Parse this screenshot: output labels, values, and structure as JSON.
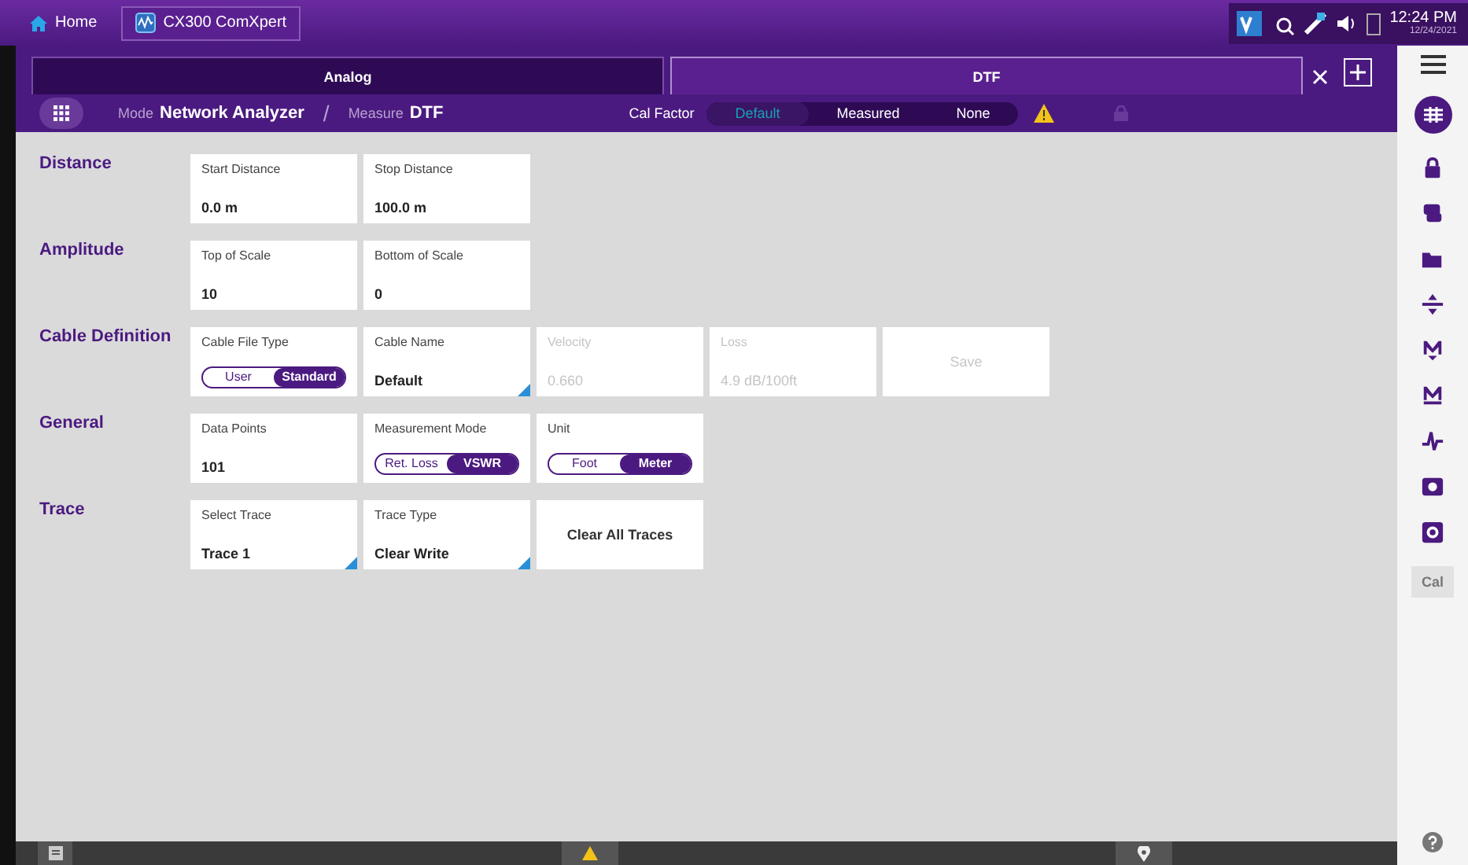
{
  "top_bar": {
    "tabs": [
      {
        "label": "Home",
        "kind": "home",
        "selected": false
      },
      {
        "label": "CX300 ComXpert",
        "kind": "app",
        "selected": true
      }
    ],
    "time": "12:24 PM",
    "date": "12/24/2021"
  },
  "app_tabs": [
    {
      "label": "Analog",
      "selected": false
    },
    {
      "label": "DTF",
      "selected": true
    }
  ],
  "mode_bar": {
    "mode_label": "Mode",
    "mode": "Network Analyzer",
    "separator": "/",
    "measure_label": "Measure",
    "measure": "DTF",
    "cal_factor": {
      "label": "Cal Factor",
      "options": [
        {
          "label": "Default",
          "selected": true
        },
        {
          "label": "Measured",
          "selected": false
        },
        {
          "label": "None",
          "selected": false
        }
      ]
    }
  },
  "sections": [
    {
      "title": "Distance",
      "cards": [
        {
          "kind": "value",
          "label": "Start Distance",
          "value": "0.0 m",
          "dropdown": false,
          "disabled": false
        },
        {
          "kind": "value",
          "label": "Stop Distance",
          "value": "100.0 m",
          "dropdown": false,
          "disabled": false
        }
      ]
    },
    {
      "title": "Amplitude",
      "cards": [
        {
          "kind": "value",
          "label": "Top of Scale",
          "value": "10",
          "dropdown": false,
          "disabled": false
        },
        {
          "kind": "value",
          "label": "Bottom of Scale",
          "value": "0",
          "dropdown": false,
          "disabled": false
        }
      ]
    },
    {
      "title": "Cable Definition",
      "cards": [
        {
          "kind": "toggle",
          "label": "Cable File Type",
          "options": [
            {
              "label": "User",
              "selected": false
            },
            {
              "label": "Standard",
              "selected": true
            }
          ]
        },
        {
          "kind": "value",
          "label": "Cable Name",
          "value": "Default",
          "dropdown": true,
          "disabled": false
        },
        {
          "kind": "value",
          "label": "Velocity",
          "value": "0.660",
          "dropdown": false,
          "disabled": true
        },
        {
          "kind": "value",
          "label": "Loss",
          "value": "4.9 dB/100ft",
          "dropdown": false,
          "disabled": true
        },
        {
          "kind": "button",
          "label": "Save",
          "disabled": true
        }
      ]
    },
    {
      "title": "General",
      "cards": [
        {
          "kind": "value",
          "label": "Data Points",
          "value": "101",
          "dropdown": false,
          "disabled": false
        },
        {
          "kind": "toggle",
          "label": "Measurement Mode",
          "options": [
            {
              "label": "Ret. Loss",
              "selected": false
            },
            {
              "label": "VSWR",
              "selected": true
            }
          ]
        },
        {
          "kind": "toggle",
          "label": "Unit",
          "options": [
            {
              "label": "Foot",
              "selected": false
            },
            {
              "label": "Meter",
              "selected": true
            }
          ]
        }
      ]
    },
    {
      "title": "Trace",
      "cards": [
        {
          "kind": "value",
          "label": "Select Trace",
          "value": "Trace 1",
          "dropdown": true,
          "disabled": false
        },
        {
          "kind": "value",
          "label": "Trace Type",
          "value": "Clear Write",
          "dropdown": true,
          "disabled": false
        },
        {
          "kind": "button",
          "label": "Clear All Traces",
          "disabled": false
        }
      ]
    }
  ],
  "sidebar": {
    "cal_button": {
      "label": "Cal",
      "disabled": true
    }
  }
}
